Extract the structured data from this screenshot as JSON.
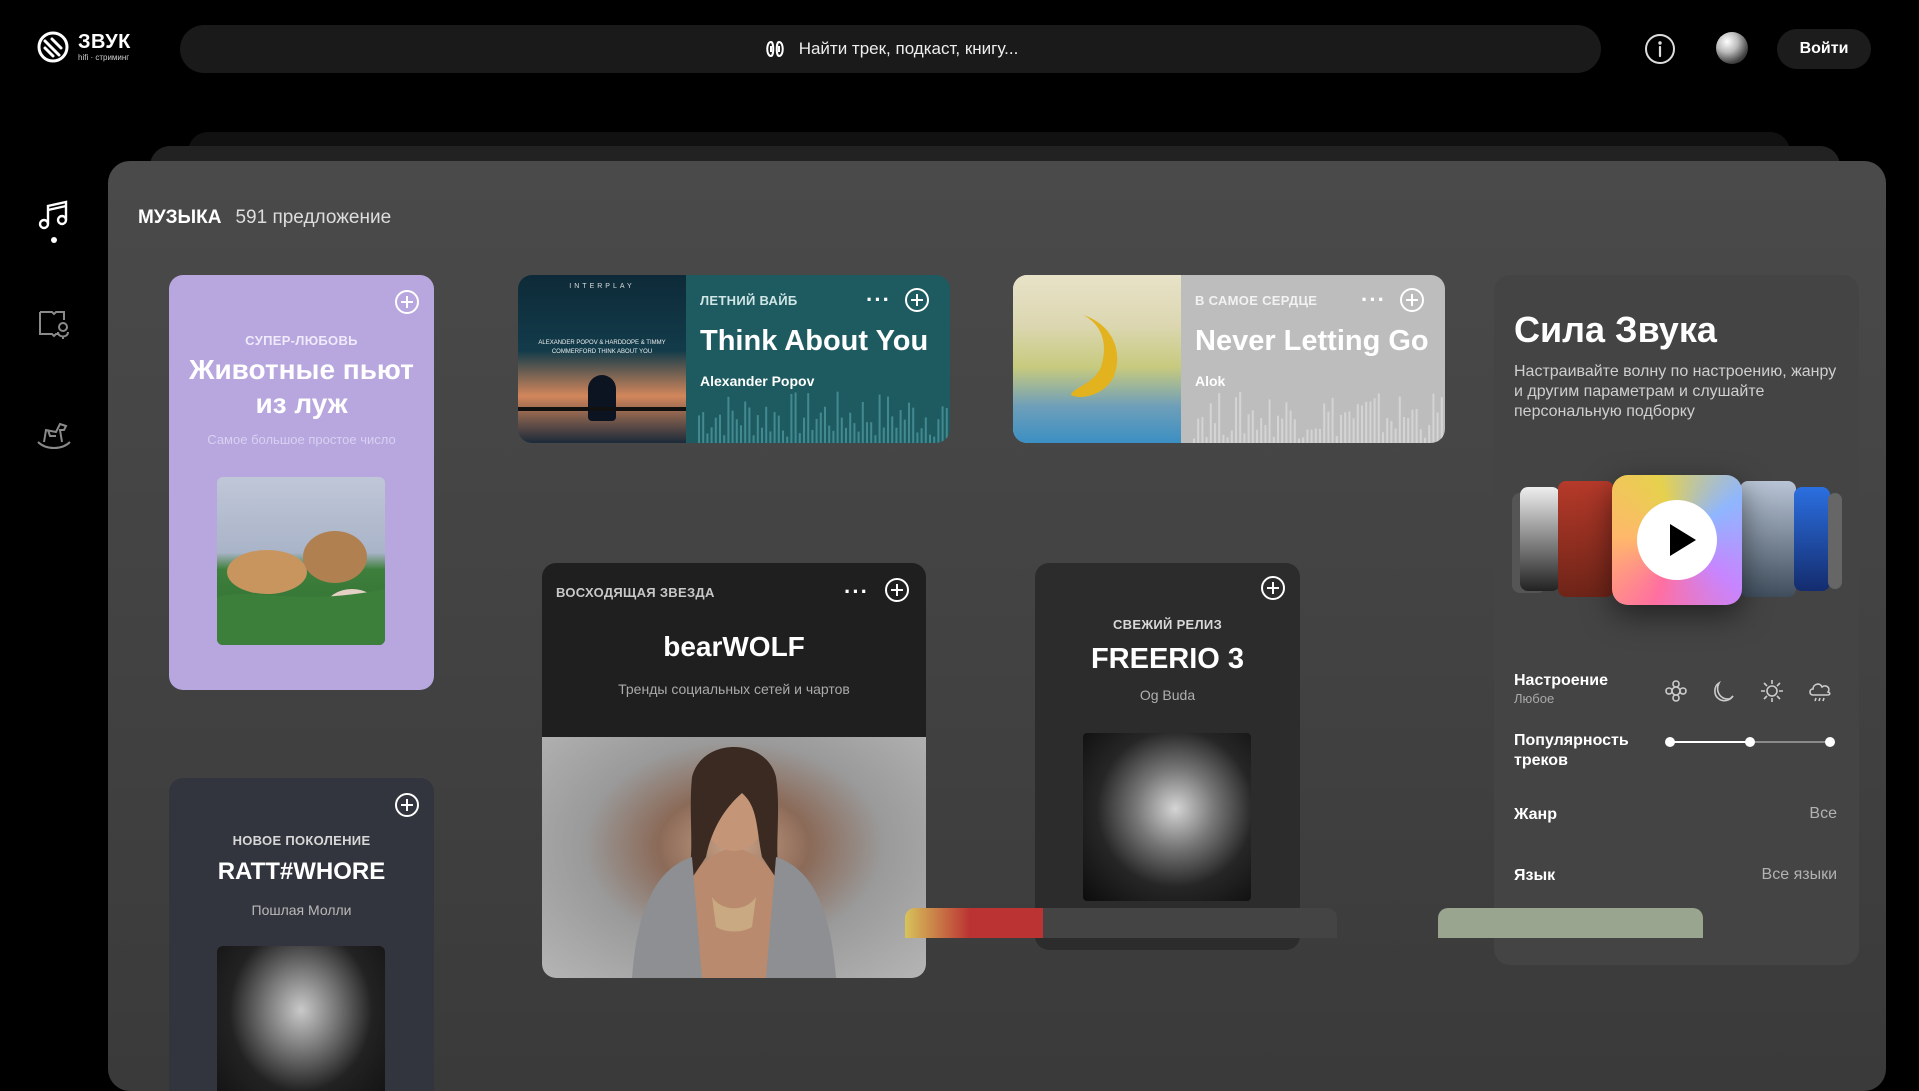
{
  "header": {
    "logo_name": "ЗВУК",
    "logo_sub": "hifi · стриминг",
    "search_placeholder": "Найти трек, подкаст, книгу...",
    "login_label": "Войти"
  },
  "sidebar": {
    "items": [
      {
        "name": "music",
        "icon": "music-note-icon",
        "active": true
      },
      {
        "name": "podcasts",
        "icon": "podcast-book-icon",
        "active": false
      },
      {
        "name": "kids",
        "icon": "kids-rocking-horse-icon",
        "active": false
      }
    ]
  },
  "section": {
    "title": "МУЗЫКА",
    "count": "591 предложение"
  },
  "cards": {
    "super_love": {
      "kicker": "СУПЕР-ЛЮБОВЬ",
      "title": "Животные пьют из луж",
      "subtitle": "Самое большое простое число"
    },
    "new_gen": {
      "kicker": "НОВОЕ ПОКОЛЕНИЕ",
      "title": "RATT#WHORE",
      "subtitle": "Пошлая Молли"
    },
    "summer_vibe": {
      "kicker": "ЛЕТНИЙ ВАЙБ",
      "title": "Think About You",
      "artist": "Alexander Popov",
      "cover_brand": "INTERPLAY",
      "cover_text": "ALEXANDER POPOV & HARDDOPE & TIMMY COMMERFORD THINK ABOUT YOU"
    },
    "to_heart": {
      "kicker": "В САМОЕ СЕРДЦЕ",
      "title": "Never Letting Go",
      "artist": "Alok"
    },
    "rising_star": {
      "kicker": "ВОСХОДЯЩАЯ ЗВЕЗДА",
      "title": "bearWOLF",
      "subtitle": "Тренды социальных сетей и чартов"
    },
    "fresh_release": {
      "kicker": "СВЕЖИЙ РЕЛИЗ",
      "title": "FREERIO 3",
      "subtitle": "Og Buda"
    }
  },
  "wave_panel": {
    "title": "Сила Звука",
    "description": "Настраивайте волну по настроению, жанру и другим параметрам и слушайте персональную подборку",
    "mood_label": "Настроение",
    "mood_value": "Любое",
    "mood_icons": [
      "flower-icon",
      "moon-icon",
      "sun-icon",
      "cloud-rain-icon"
    ],
    "popularity_label": "Популярность треков",
    "popularity_slider": {
      "low": 0,
      "mid": 0.5,
      "high": 1
    },
    "genre_label": "Жанр",
    "genre_value": "Все",
    "language_label": "Язык",
    "language_value": "Все языки"
  }
}
